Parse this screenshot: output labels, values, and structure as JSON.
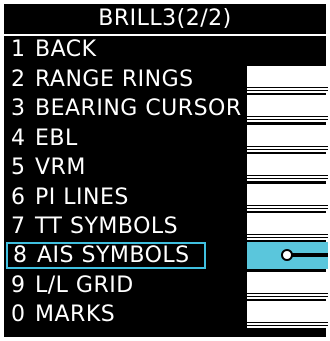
{
  "menu": {
    "title": "BRILL3(2/2)",
    "items": [
      {
        "num": "1",
        "label": "BACK",
        "has_value": false,
        "selected": false
      },
      {
        "num": "2",
        "label": "RANGE RINGS",
        "has_value": true,
        "selected": false
      },
      {
        "num": "3",
        "label": "BEARING CURSOR",
        "has_value": true,
        "selected": false
      },
      {
        "num": "4",
        "label": "EBL",
        "has_value": true,
        "selected": false
      },
      {
        "num": "5",
        "label": "VRM",
        "has_value": true,
        "selected": false
      },
      {
        "num": "6",
        "label": "PI LINES",
        "has_value": true,
        "selected": false
      },
      {
        "num": "7",
        "label": "TT SYMBOLS",
        "has_value": true,
        "selected": false
      },
      {
        "num": "8",
        "label": "AIS SYMBOLS",
        "has_value": true,
        "selected": true
      },
      {
        "num": "9",
        "label": "L/L GRID",
        "has_value": true,
        "selected": false
      },
      {
        "num": "0",
        "label": "MARKS",
        "has_value": true,
        "selected": false
      }
    ]
  },
  "colors": {
    "background": "#000000",
    "text": "#ffffff",
    "selection_border": "#40c0e0",
    "selection_fill": "#5ac6dc"
  }
}
